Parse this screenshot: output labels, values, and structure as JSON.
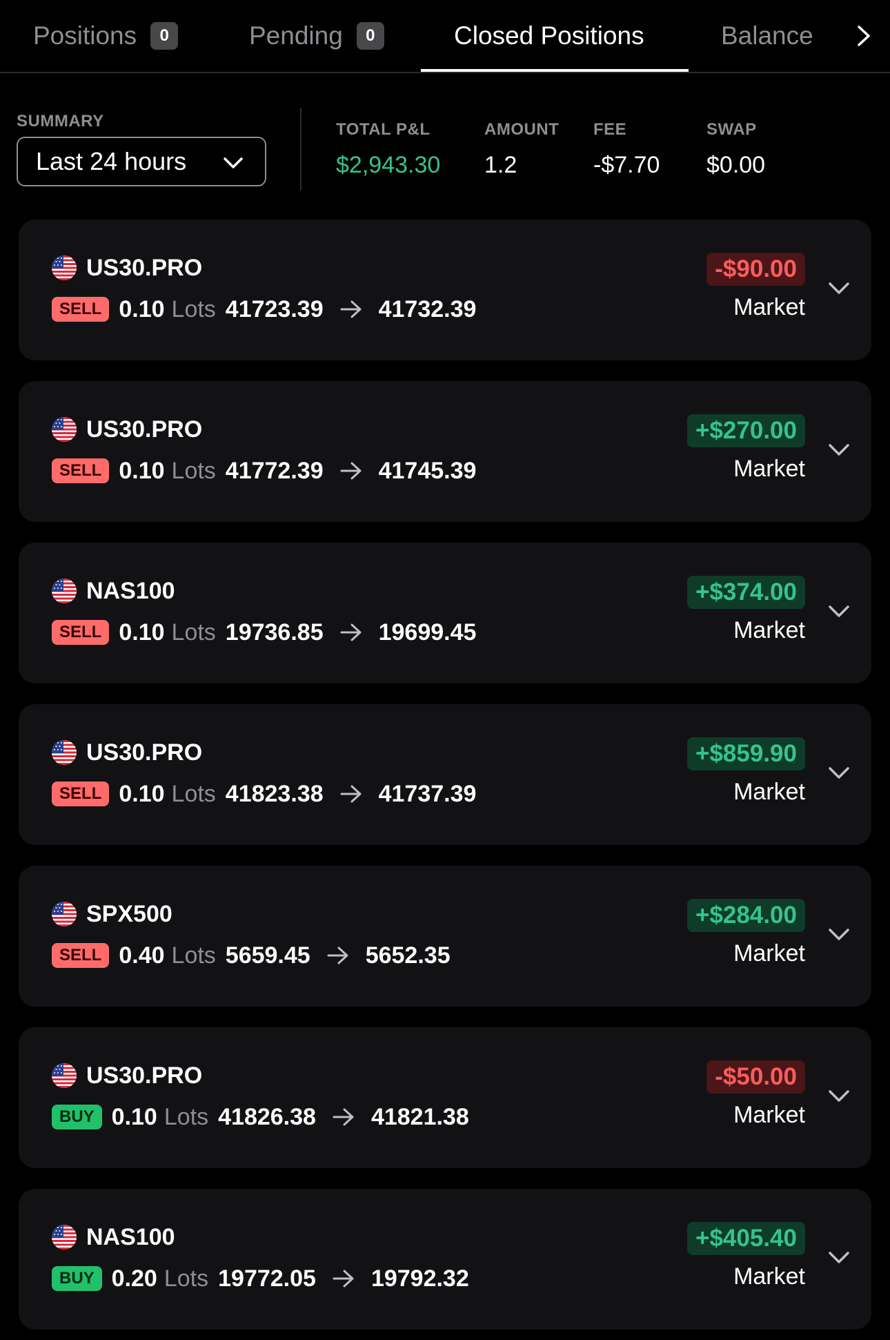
{
  "tabs": [
    {
      "label": "Positions",
      "count": "0",
      "active": false
    },
    {
      "label": "Pending",
      "count": "0",
      "active": false
    },
    {
      "label": "Closed Positions",
      "active": true
    },
    {
      "label": "Balance",
      "active": false
    }
  ],
  "summary": {
    "label": "SUMMARY",
    "period": "Last 24 hours",
    "total_pnl_label": "TOTAL P&L",
    "total_pnl": "$2,943.30",
    "amount_label": "AMOUNT",
    "amount": "1.2",
    "fee_label": "FEE",
    "fee": "-$7.70",
    "swap_label": "SWAP",
    "swap": "$0.00"
  },
  "positions": [
    {
      "symbol": "US30.PRO",
      "side": "SELL",
      "lots": "0.10",
      "lots_label": "Lots",
      "open_price": "41723.39",
      "close_price": "41732.39",
      "pnl": "-$90.00",
      "pnl_sign": "negative",
      "order_type": "Market"
    },
    {
      "symbol": "US30.PRO",
      "side": "SELL",
      "lots": "0.10",
      "lots_label": "Lots",
      "open_price": "41772.39",
      "close_price": "41745.39",
      "pnl": "+$270.00",
      "pnl_sign": "positive",
      "order_type": "Market"
    },
    {
      "symbol": "NAS100",
      "side": "SELL",
      "lots": "0.10",
      "lots_label": "Lots",
      "open_price": "19736.85",
      "close_price": "19699.45",
      "pnl": "+$374.00",
      "pnl_sign": "positive",
      "order_type": "Market"
    },
    {
      "symbol": "US30.PRO",
      "side": "SELL",
      "lots": "0.10",
      "lots_label": "Lots",
      "open_price": "41823.38",
      "close_price": "41737.39",
      "pnl": "+$859.90",
      "pnl_sign": "positive",
      "order_type": "Market"
    },
    {
      "symbol": "SPX500",
      "side": "SELL",
      "lots": "0.40",
      "lots_label": "Lots",
      "open_price": "5659.45",
      "close_price": "5652.35",
      "pnl": "+$284.00",
      "pnl_sign": "positive",
      "order_type": "Market"
    },
    {
      "symbol": "US30.PRO",
      "side": "BUY",
      "lots": "0.10",
      "lots_label": "Lots",
      "open_price": "41826.38",
      "close_price": "41821.38",
      "pnl": "-$50.00",
      "pnl_sign": "negative",
      "order_type": "Market"
    },
    {
      "symbol": "NAS100",
      "side": "BUY",
      "lots": "0.20",
      "lots_label": "Lots",
      "open_price": "19772.05",
      "close_price": "19792.32",
      "pnl": "+$405.40",
      "pnl_sign": "positive",
      "order_type": "Market"
    }
  ],
  "icons": {
    "flag": "us-flag-icon",
    "arrow": "arrow-right-icon",
    "expand": "chevron-down-icon",
    "tabs_next": "chevron-right-icon"
  },
  "colors": {
    "background": "#000000",
    "card": "#121214",
    "profit": "#34c48b",
    "loss": "#ff5c5c",
    "sell_badge": "#ff6b6b",
    "buy_badge": "#21c16b"
  }
}
